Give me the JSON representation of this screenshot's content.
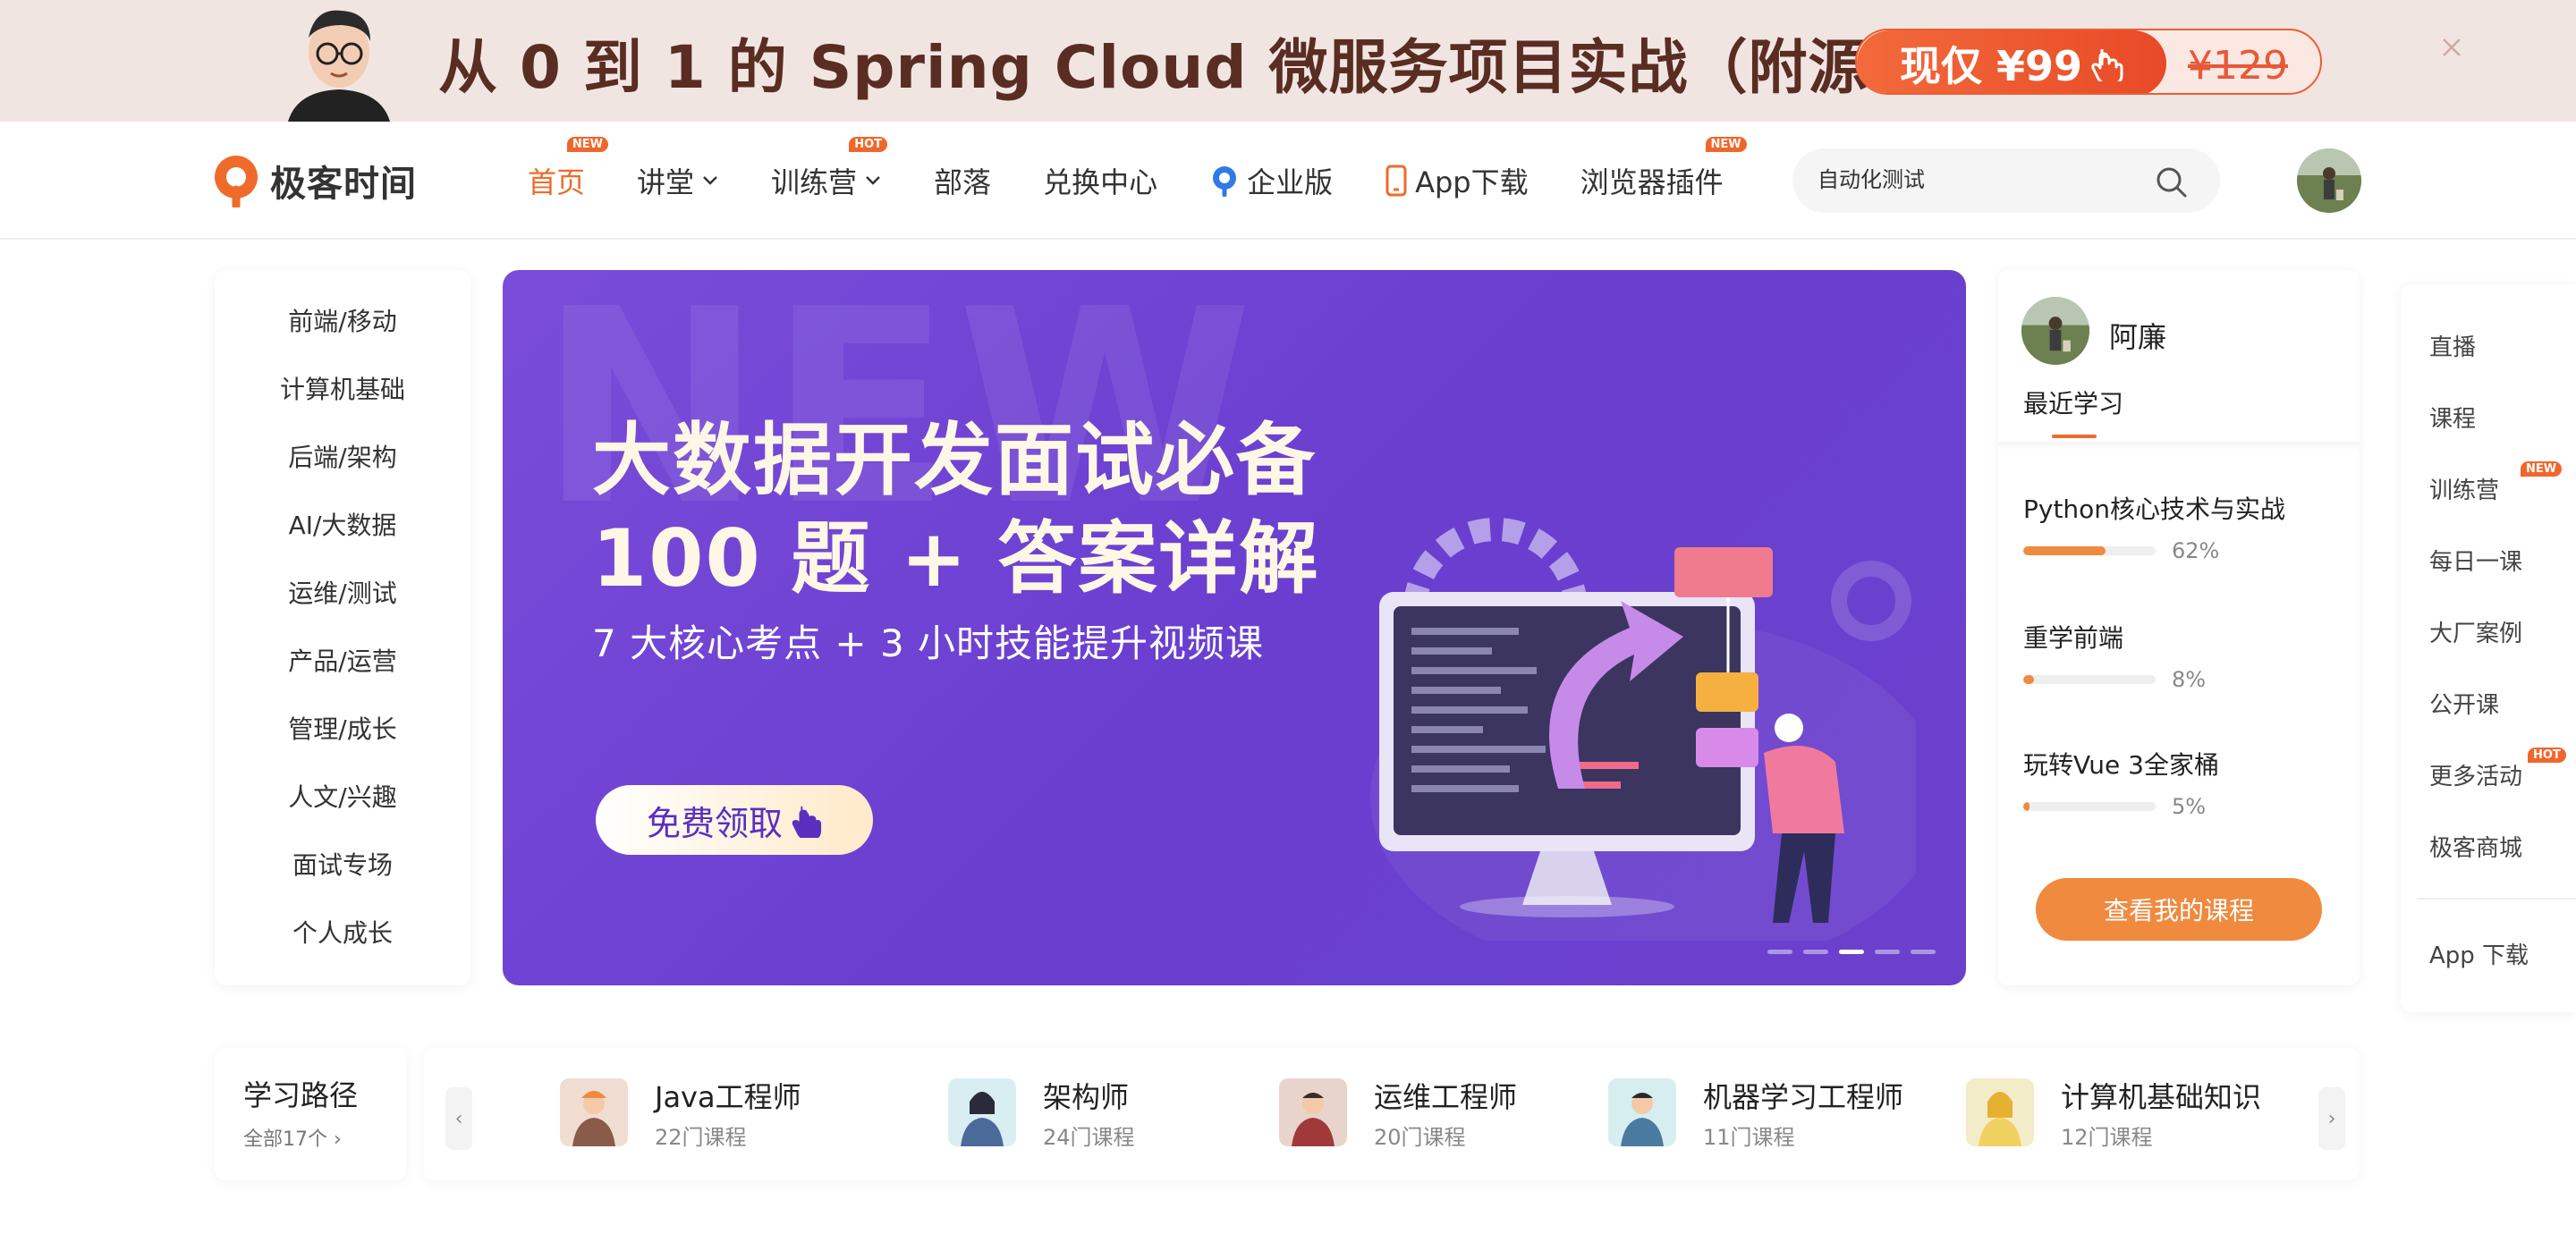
{
  "promo": {
    "text": "从 0 到 1 的 Spring Cloud 微服务项目实战（附源码）",
    "price_now": "现仅 ¥99",
    "price_old": "¥129"
  },
  "header": {
    "logo_text": "极客时间",
    "nav": [
      {
        "label": "首页",
        "badge": "NEW",
        "active": true
      },
      {
        "label": "讲堂",
        "has_dropdown": true
      },
      {
        "label": "训练营",
        "badge": "HOT",
        "has_dropdown": true
      },
      {
        "label": "部落"
      },
      {
        "label": "兑换中心"
      },
      {
        "label": "企业版"
      },
      {
        "label": "App下载"
      },
      {
        "label": "浏览器插件",
        "badge": "NEW"
      }
    ],
    "search_value": "自动化测试"
  },
  "categories": [
    "前端/移动",
    "计算机基础",
    "后端/架构",
    "AI/大数据",
    "运维/测试",
    "产品/运营",
    "管理/成长",
    "人文/兴趣",
    "面试专场",
    "个人成长"
  ],
  "hero": {
    "bg_text": "NEW",
    "title_line1": "大数据开发面试必备",
    "title_line2": "100 题 + 答案详解",
    "subtitle": "7 大核心考点 + 3 小时技能提升视频课",
    "button": "免费领取",
    "slide_count": 5,
    "active_slide": 3
  },
  "learn": {
    "user_name": "阿廉",
    "tab": "最近学习",
    "courses": [
      {
        "title": "Python核心技术与实战",
        "progress": 62,
        "pct_label": "62%"
      },
      {
        "title": "重学前端",
        "progress": 8,
        "pct_label": "8%"
      },
      {
        "title": "玩转Vue 3全家桶",
        "progress": 5,
        "pct_label": "5%"
      }
    ],
    "button": "查看我的课程"
  },
  "side": {
    "items": [
      {
        "label": "直播"
      },
      {
        "label": "课程"
      },
      {
        "label": "训练营",
        "badge": "NEW"
      },
      {
        "label": "每日一课"
      },
      {
        "label": "大厂案例"
      },
      {
        "label": "公开课"
      },
      {
        "label": "更多活动",
        "badge": "HOT"
      },
      {
        "label": "极客商城"
      }
    ],
    "app_download": "App 下载"
  },
  "path": {
    "title": "学习路径",
    "all": "全部17个",
    "items": [
      {
        "name": "Java工程师",
        "count": "22门课程"
      },
      {
        "name": "架构师",
        "count": "24门课程"
      },
      {
        "name": "运维工程师",
        "count": "20门课程"
      },
      {
        "name": "机器学习工程师",
        "count": "11门课程"
      },
      {
        "name": "计算机基础知识",
        "count": "12门课程"
      }
    ]
  },
  "colors": {
    "accent": "#ef6b2b",
    "hero_bg": "#7048d2",
    "progress": "#ef8a3f"
  }
}
